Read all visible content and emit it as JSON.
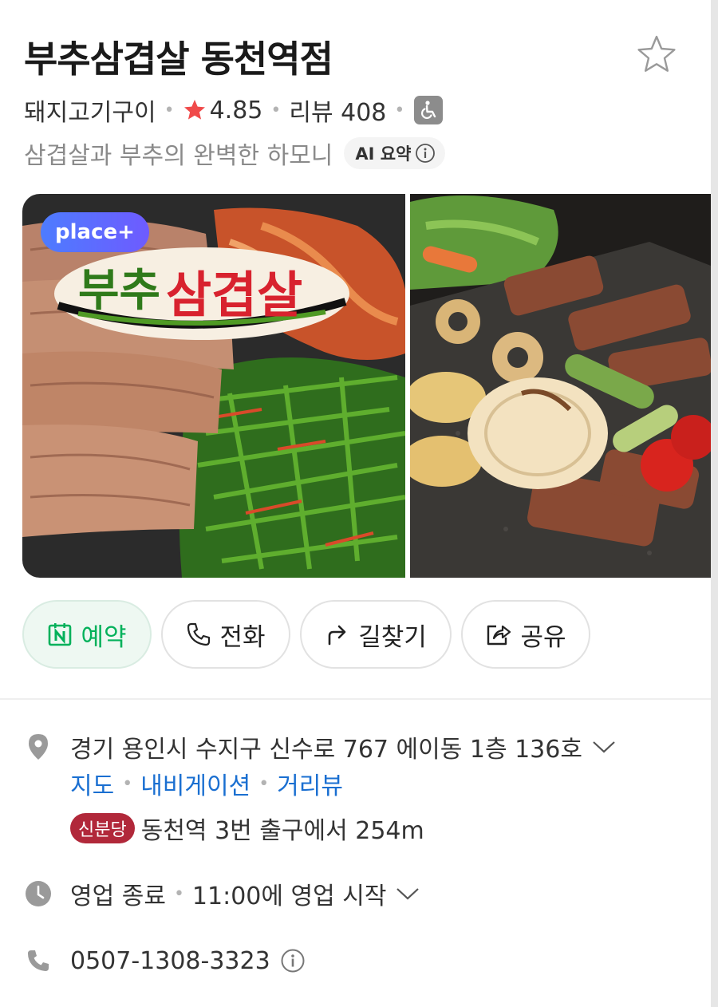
{
  "header": {
    "title": "부추삼겹살 동천역점",
    "favorite_icon": "star-outline-icon"
  },
  "meta": {
    "category": "돼지고기구이",
    "rating": "4.85",
    "review_label": "리뷰 408",
    "accessibility_icon": "wheelchair-icon",
    "rating_color": "#f04a4a"
  },
  "summary": {
    "text": "삼겹살과 부추의 완벽한 하모니",
    "ai_badge": "AI 요약"
  },
  "gallery": {
    "badge": "place+",
    "logo_text": "부추삼겹살",
    "photos": [
      "grilled-pork-belly-with-chives",
      "grill-plate-with-vegetables"
    ]
  },
  "actions": [
    {
      "label": "예약",
      "icon": "naver-calendar-icon",
      "color": "#03b15b"
    },
    {
      "label": "전화",
      "icon": "phone-icon"
    },
    {
      "label": "길찾기",
      "icon": "directions-arrow-icon"
    },
    {
      "label": "공유",
      "icon": "share-icon"
    }
  ],
  "details": {
    "address": "경기 용인시 수지구 신수로 767 에이동 1층 136호",
    "links": [
      "지도",
      "내비게이션",
      "거리뷰"
    ],
    "subway_line": "신분당",
    "subway_line_color": "#b1283a",
    "subway_text": "동천역 3번 출구에서 254m",
    "hours_status": "영업 종료",
    "hours_next": "11:00에 영업 시작",
    "phone": "0507-1308-3323"
  }
}
